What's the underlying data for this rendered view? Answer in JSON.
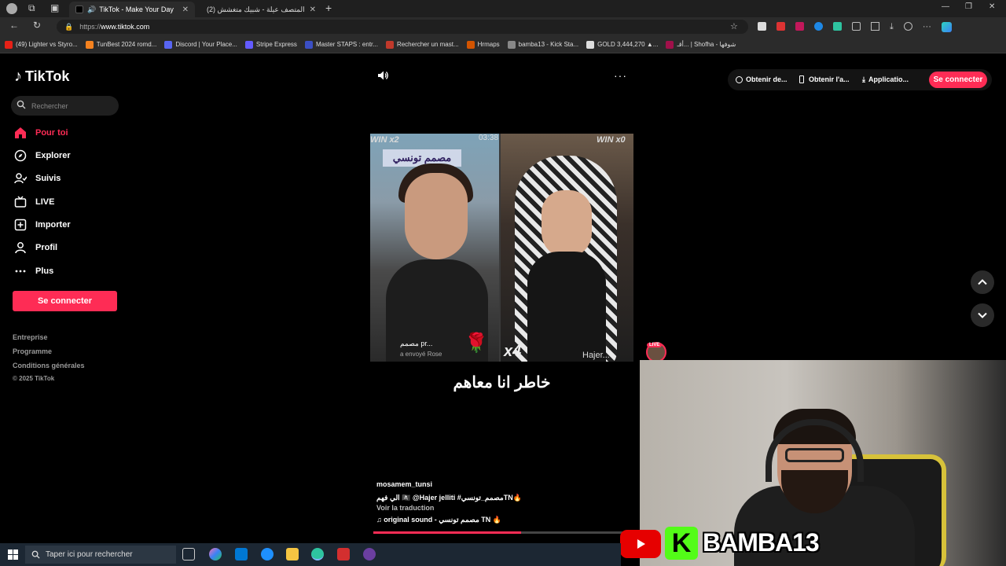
{
  "browser": {
    "tabs": [
      {
        "title": "TikTok - Make Your Day",
        "active": true
      },
      {
        "title": "(2) المتصف عيلة - شبيك متغشش",
        "active": false
      }
    ],
    "url_prefix": "https://",
    "url_host": "www.tiktok.com",
    "bookmarks": [
      {
        "label": "(49) Lighter vs Styro...",
        "color": "#e62117"
      },
      {
        "label": "TunBest 2024 romd...",
        "color": "#f5821f"
      },
      {
        "label": "Discord | Your Place...",
        "color": "#5865f2"
      },
      {
        "label": "Stripe Express",
        "color": "#635bff"
      },
      {
        "label": "Master STAPS : entr...",
        "color": "#3b4fc4"
      },
      {
        "label": "Rechercher un mast...",
        "color": "#c0392b"
      },
      {
        "label": "Hrmaps",
        "color": "#d35400"
      },
      {
        "label": "bamba13 - Kick Sta...",
        "color": "#888888"
      },
      {
        "label": "GOLD 3,444,270 ▲...",
        "color": "#dddddd"
      },
      {
        "label": "أقـ... | Shofha - شوفها",
        "color": "#a0104a"
      }
    ]
  },
  "tiktok": {
    "logo": "TikTok",
    "search_placeholder": "Rechercher",
    "nav": [
      {
        "label": "Pour toi",
        "icon": "home-icon",
        "active": true
      },
      {
        "label": "Explorer",
        "icon": "compass-icon",
        "active": false
      },
      {
        "label": "Suivis",
        "icon": "following-icon",
        "active": false
      },
      {
        "label": "LIVE",
        "icon": "live-icon",
        "active": false
      },
      {
        "label": "Importer",
        "icon": "upload-icon",
        "active": false
      },
      {
        "label": "Profil",
        "icon": "profile-icon",
        "active": false
      },
      {
        "label": "Plus",
        "icon": "more-icon",
        "active": false
      }
    ],
    "login_label": "Se connecter",
    "footer": [
      "Entreprise",
      "Programme",
      "Conditions générales",
      "© 2025 TikTok"
    ],
    "top_actions": [
      "Obtenir de...",
      "Obtenir l'a...",
      "Applicatio..."
    ],
    "top_login": "Se connecter",
    "more_label": "···",
    "video": {
      "win_left": "WIN x2",
      "win_right": "WIN x0",
      "timer": "03:38",
      "sign_text": "مصمم تونسي",
      "count_text": "x4",
      "hajer_text": "Hajer...",
      "sent_text": "a envoyé Rose",
      "gifter_text": "مصمم pr...",
      "caption": "خاطر انا معاهم",
      "author": "mosamem_tunsi",
      "description": "الي فهم 🏴‍☠️ @Hajer jelliti #مصمم_تونسيTN🔥",
      "translate_label": "Voir la traduction",
      "sound": "original sound - مصمم تونسي TN 🔥",
      "progress": 0.56,
      "live_badge": "LIVE"
    }
  },
  "overlay": {
    "brand": "BAMBA13",
    "kick_letter": "K"
  },
  "taskbar": {
    "search_placeholder": "Taper ici pour rechercher"
  }
}
